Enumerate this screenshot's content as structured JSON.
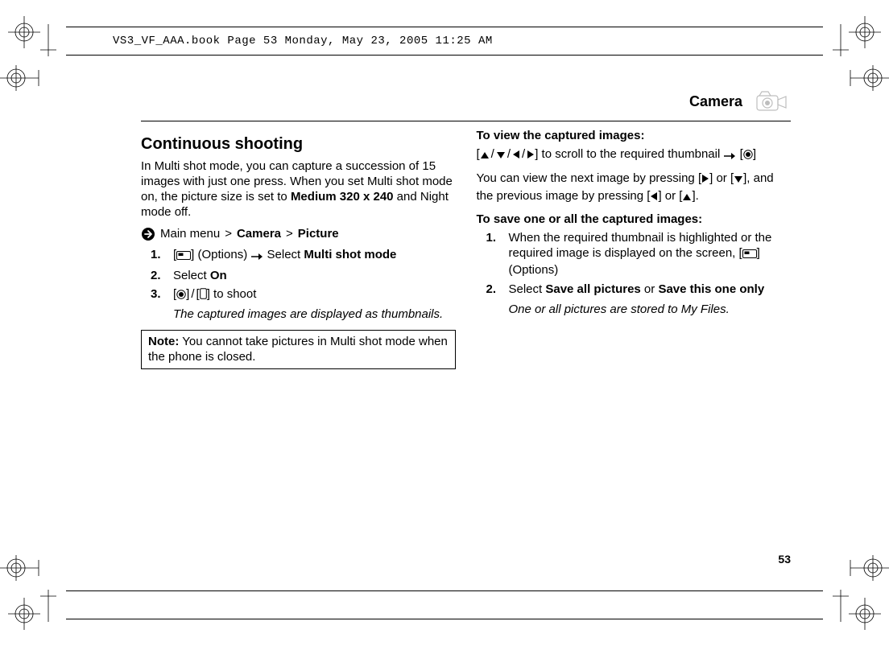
{
  "doc_header": "VS3_VF_AAA.book  Page 53  Monday, May 23, 2005  11:25 AM",
  "section_title": "Camera",
  "page_number": "53",
  "left": {
    "heading": "Continuous shooting",
    "intro_pre": "In Multi shot mode, you can capture a succession of 15 images with just one press. When you set Multi shot mode on, the picture size is set to ",
    "intro_bold": "Medium 320 x 240",
    "intro_post": " and Night mode off.",
    "bc_main": "Main menu",
    "bc_sep": ">",
    "bc_camera": "Camera",
    "bc_picture": "Picture",
    "step1_a": "] (Options) ",
    "step1_b": " Select ",
    "step1_c": "Multi shot mode",
    "step2_a": "Select ",
    "step2_b": "On",
    "step3_a": "] to shoot",
    "step3_note": "The captured images are displayed as thumbnails.",
    "note_label": "Note:",
    "note_text": "  You cannot take pictures in Multi shot mode when the phone is closed."
  },
  "right": {
    "h1": "To view the captured images:",
    "line1_mid": "] to scroll to the required thumbnail ",
    "line2_a": "You can view the next image by pressing [",
    "line2_b": "] or [",
    "line2_c": "], and the previous image by pressing [",
    "line2_d": "] or [",
    "line2_e": "].",
    "h2": "To save one or all the captured images:",
    "s1": "When the required thumbnail is highlighted or the required image is displayed on the screen, [",
    "s1b": "] (Options)",
    "s2_a": "Select ",
    "s2_b": "Save all pictures",
    "s2_or": " or ",
    "s2_c": "Save this one only",
    "s2_note": "One or all pictures are stored to My Files."
  },
  "nums": {
    "n1": "1.",
    "n2": "2.",
    "n3": "3."
  }
}
